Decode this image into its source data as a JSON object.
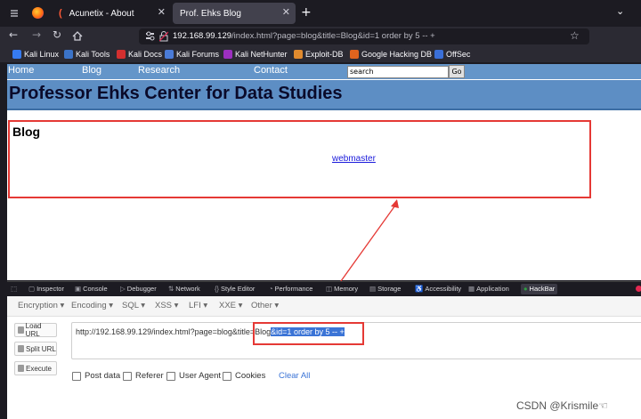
{
  "browser": {
    "tabs": [
      {
        "title": "Acunetix - About"
      },
      {
        "title": "Prof. Ehks Blog"
      }
    ],
    "url": {
      "host": "192.168.99.129",
      "path": "/index.html?page=blog&title=Blog&id=1 order by 5 -- +"
    },
    "bookmarks": [
      "Kali Linux",
      "Kali Tools",
      "Kali Docs",
      "Kali Forums",
      "Kali NetHunter",
      "Exploit-DB",
      "Google Hacking DB",
      "OffSec"
    ],
    "bookmark_colors": [
      "#367bf0",
      "#3b73c8",
      "#d32f2f",
      "#4a7bd8",
      "#9c2fc0",
      "#e08a2e",
      "#e0641e",
      "#3a6fd8"
    ]
  },
  "site": {
    "nav": [
      "Home",
      "Blog",
      "Research",
      "Contact"
    ],
    "search_value": "search",
    "go_label": "Go",
    "title": "Professor Ehks Center for Data Studies",
    "blog_heading": "Blog",
    "blog_link": "webmaster"
  },
  "devtools": {
    "tabs": [
      "Inspector",
      "Console",
      "Debugger",
      "Network",
      "Style Editor",
      "Performance",
      "Memory",
      "Storage",
      "Accessibility",
      "Application",
      "HackBar"
    ]
  },
  "hackbar": {
    "menus": [
      "Encryption",
      "Encoding",
      "SQL",
      "XSS",
      "LFI",
      "XXE",
      "Other"
    ],
    "buttons": [
      "Load URL",
      "Split URL",
      "Execute"
    ],
    "url_prefix": "http://192.168.99.129/index.html?page=blog&title=Blog",
    "url_selected": "&id=1 order by 5 -- +",
    "options": [
      "Post data",
      "Referer",
      "User Agent",
      "Cookies"
    ],
    "clear_label": "Clear All"
  },
  "watermark": "CSDN @Krismile☜"
}
